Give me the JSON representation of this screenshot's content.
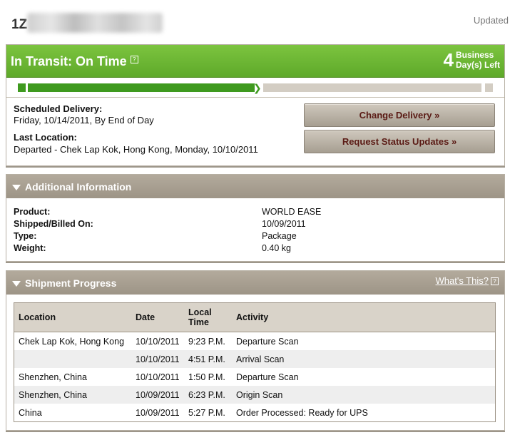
{
  "header": {
    "tracking_prefix": "1Z",
    "updated_label": "Updated"
  },
  "status": {
    "title": "In Transit: On Time",
    "help_glyph": "?",
    "days_left": "4",
    "days_label_line1": "Business",
    "days_label_line2": "Day(s) Left",
    "progress_fraction": 0.52,
    "scheduled_delivery_label": "Scheduled Delivery:",
    "scheduled_delivery_value": "Friday, 10/14/2011, By End of Day",
    "last_location_label": "Last Location:",
    "last_location_value": "Departed - Chek Lap Kok, Hong Kong, Monday, 10/10/2011",
    "change_delivery_button": "Change Delivery »",
    "request_updates_button": "Request Status Updates »"
  },
  "additional_info": {
    "title": "Additional Information",
    "rows": [
      {
        "label": "Product:",
        "value": "WORLD EASE"
      },
      {
        "label": "Shipped/Billed On:",
        "value": "10/09/2011"
      },
      {
        "label": "Type:",
        "value": "Package"
      },
      {
        "label": "Weight:",
        "value": "0.40 kg"
      }
    ]
  },
  "shipment_progress": {
    "title": "Shipment Progress",
    "whats_this": "What's This?",
    "help_glyph": "?",
    "columns": {
      "location": "Location",
      "date": "Date",
      "local_time_line1": "Local",
      "local_time_line2": "Time",
      "activity": "Activity"
    },
    "rows": [
      {
        "location": "Chek Lap Kok, Hong Kong",
        "date": "10/10/2011",
        "time": "9:23 P.M.",
        "activity": "Departure Scan"
      },
      {
        "location": "",
        "date": "10/10/2011",
        "time": "4:51 P.M.",
        "activity": "Arrival Scan"
      },
      {
        "location": "Shenzhen, China",
        "date": "10/10/2011",
        "time": "1:50 P.M.",
        "activity": "Departure Scan"
      },
      {
        "location": "Shenzhen, China",
        "date": "10/09/2011",
        "time": "6:23 P.M.",
        "activity": "Origin Scan"
      },
      {
        "location": "China",
        "date": "10/09/2011",
        "time": "5:27 P.M.",
        "activity": "Order Processed: Ready for UPS"
      }
    ]
  },
  "colors": {
    "status_green": "#6bb634",
    "progress_green": "#3f9a1f",
    "section_header": "#a69e91",
    "button_text": "#5a1a14"
  },
  "icons": {
    "section_toggle": "triangle-down-icon",
    "help": "help-icon"
  }
}
